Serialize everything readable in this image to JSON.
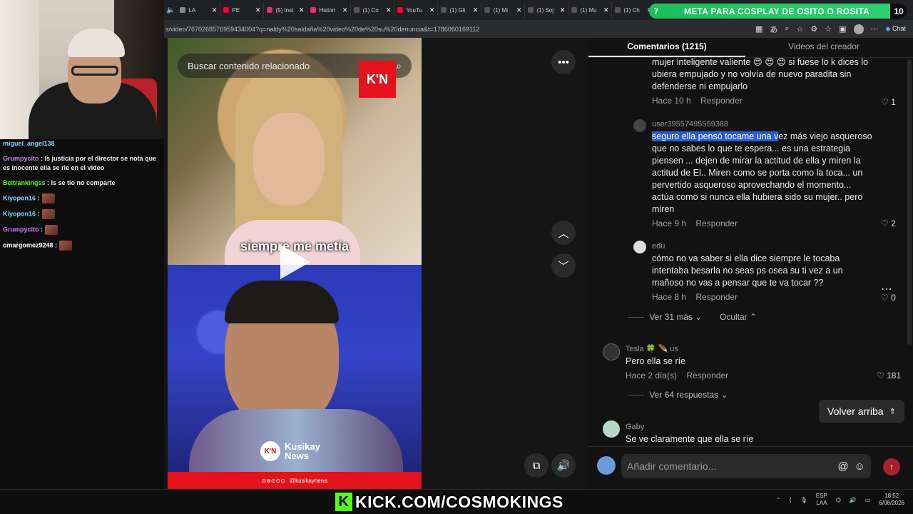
{
  "browser": {
    "tabs": [
      {
        "label": "LA",
        "color": "#888888"
      },
      {
        "label": "PE",
        "color": "#ff0033"
      },
      {
        "label": "(5) Inst",
        "color": "#e1306c"
      },
      {
        "label": "Histori",
        "color": "#e1306c"
      },
      {
        "label": "(1) Co",
        "color": "#555555"
      },
      {
        "label": "YouTu",
        "color": "#ff0033"
      },
      {
        "label": "(1) Gli",
        "color": "#555555"
      },
      {
        "label": "(1) Mi",
        "color": "#555555"
      },
      {
        "label": "(1) Soj",
        "color": "#555555"
      },
      {
        "label": "(1) Mu",
        "color": "#555555"
      },
      {
        "label": "(1) Ch",
        "color": "#555555"
      }
    ],
    "promo_left": "7",
    "promo_text": "META PARA COSPLAY DE OSITO O ROSITA",
    "promo_right": "10",
    "url": "s/video/7670268576959434004?q=naldy%20saldaña%20video%20de%20su%20denuncia&t=1786060169112",
    "chat_label": "Chat"
  },
  "stream_chat": [
    {
      "user": "miguel_angel138",
      "color": "#7fd6ff",
      "text": ""
    },
    {
      "user": "Grumpycito",
      "color": "#c77dff",
      "text": ": Is justicia por el director se nota que es inocente ella se rie en el video"
    },
    {
      "user": "Beltrankingss",
      "color": "#53fc18",
      "text": ": Is se tio no comparte"
    },
    {
      "user": "Kiyopon16",
      "color": "#7fd6ff",
      "text": ":"
    },
    {
      "user": "Kiyopon16",
      "color": "#7fd6ff",
      "text": ":"
    },
    {
      "user": "Grumpycito",
      "color": "#c77dff",
      "text": ":"
    },
    {
      "user": "omargomez9248",
      "color": "#ffffff",
      "text": ":"
    }
  ],
  "video": {
    "search_placeholder": "Buscar contenido relacionado",
    "logo": "K'N",
    "caption": "siempre me metía",
    "brand_line1": "Kusikay",
    "brand_line2": "News",
    "footer": "@kusikaynews"
  },
  "panel": {
    "tab_comments": "Comentarios (1215)",
    "tab_creator": "Videos del creador",
    "comments": [
      {
        "user": "",
        "text": "mujer inteligente valiente 😍 😍 😍 si fuese lo k dices lo ubiera empujado y no volvía de nuevo paradita sin defenderse ni empujarlo",
        "time": "Hace 10 h",
        "reply": "Responder",
        "likes": "1"
      },
      {
        "user": "user39557495559388",
        "text_hl": "seguro ella pensó tocame una v",
        "text": "ez más viejo asqueroso que no sabes lo que te espera... es una estrategia piensen ... dejen de mirar la actitud de ella y miren la actitud de El.. Miren como se porta como la toca... un pervertido asqueroso aprovechando el momento... actúa como si nunca ella hubiera sido su mujer.. pero miren",
        "time": "Hace 9 h",
        "reply": "Responder",
        "likes": "2"
      },
      {
        "user": "edu",
        "text": "cómo no va saber si ella dice siempre le tocaba intentaba besarla no seas ps osea su ti vez a un mañoso no vas a pensar que te va tocar ??",
        "time": "Hace 8 h",
        "reply": "Responder",
        "likes": "0"
      }
    ],
    "see_more": "Ver 31 más",
    "hide": "Ocultar",
    "top_comment": {
      "user": "Tesla 🍀 🪶 us",
      "text": "Pero ella se ríe",
      "time": "Hace 2 día(s)",
      "reply": "Responder",
      "likes": "181",
      "replies": "Ver 64 respuestas"
    },
    "last_comment": {
      "user": "Gaby",
      "text": "Se ve claramente que ella se ríe"
    },
    "back_to_top": "Volver arriba",
    "composer_placeholder": "Añadir comentario..."
  },
  "taskbar": {
    "kick_text": "KICK.COM/COSMOKINGS",
    "lang1": "ESP",
    "lang2": "LAA",
    "time": "18:52",
    "date": "6/08/2026"
  }
}
